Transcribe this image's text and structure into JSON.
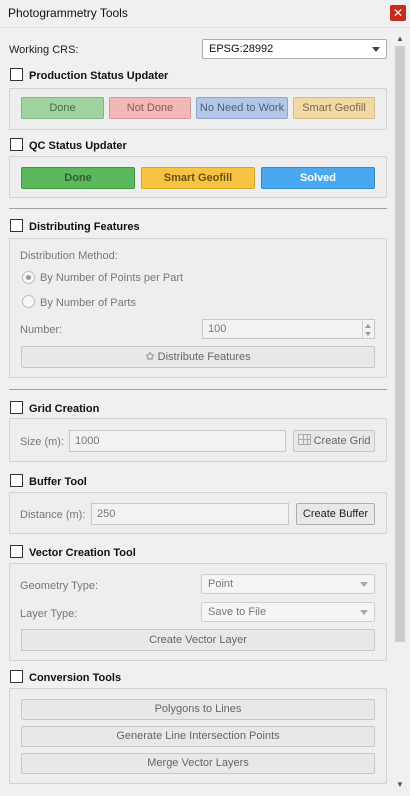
{
  "window": {
    "title": "Photogrammetry Tools",
    "close_glyph": "✕"
  },
  "crs": {
    "label": "Working CRS:",
    "value": "EPSG:28992"
  },
  "production": {
    "title": "Production Status Updater",
    "buttons": [
      "Done",
      "Not Done",
      "No Need to Work",
      "Smart Geofill"
    ],
    "colors": {
      "done": "#9fd29f",
      "not_done": "#f2b7b7",
      "no_need": "#b4c7e7",
      "smart": "#f2d9a6"
    }
  },
  "qc": {
    "title": "QC Status Updater",
    "buttons": [
      "Done",
      "Smart Geofill",
      "Solved"
    ],
    "colors": {
      "done": "#5cb85c",
      "smart": "#f6c343",
      "solved": "#4aa8f0"
    }
  },
  "distribute": {
    "title": "Distributing Features",
    "method_label": "Distribution Method:",
    "option1": "By Number of Points per Part",
    "option2": "By Number of Parts",
    "number_label": "Number:",
    "number_value": "100",
    "button": "Distribute Features",
    "icon": "distribute-icon"
  },
  "grid": {
    "title": "Grid Creation",
    "size_label": "Size (m):",
    "size_value": "1000",
    "button": "Create Grid",
    "icon": "grid-icon"
  },
  "buffer": {
    "title": "Buffer Tool",
    "distance_label": "Distance (m):",
    "distance_value": "250",
    "button": "Create Buffer"
  },
  "vector": {
    "title": "Vector Creation Tool",
    "geometry_label": "Geometry Type:",
    "geometry_value": "Point",
    "layer_label": "Layer Type:",
    "layer_value": "Save to File",
    "button": "Create Vector Layer"
  },
  "conversion": {
    "title": "Conversion Tools",
    "buttons": [
      "Polygons to Lines",
      "Generate Line Intersection Points",
      "Merge Vector Layers"
    ]
  }
}
